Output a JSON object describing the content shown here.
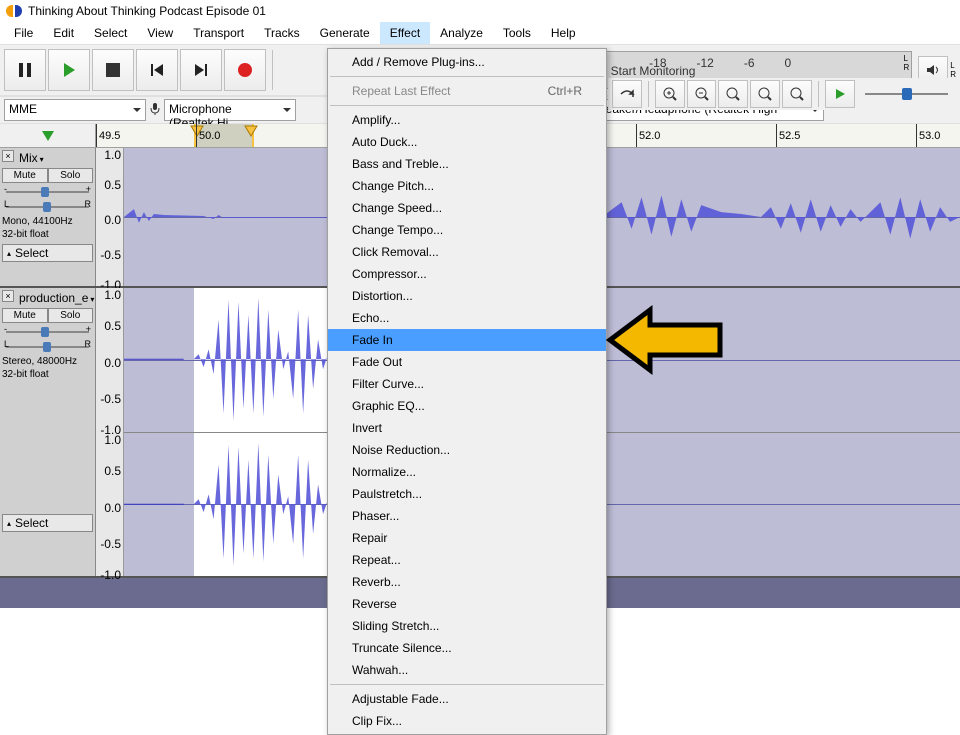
{
  "title": "Thinking About Thinking Podcast Episode 01",
  "menu": [
    "File",
    "Edit",
    "Select",
    "View",
    "Transport",
    "Tracks",
    "Generate",
    "Effect",
    "Analyze",
    "Tools",
    "Help"
  ],
  "menu_open_index": 7,
  "dropdown": {
    "top": {
      "label": "Add / Remove Plug-ins..."
    },
    "repeat": {
      "label": "Repeat Last Effect",
      "shortcut": "Ctrl+R"
    },
    "items": [
      "Amplify...",
      "Auto Duck...",
      "Bass and Treble...",
      "Change Pitch...",
      "Change Speed...",
      "Change Tempo...",
      "Click Removal...",
      "Compressor...",
      "Distortion...",
      "Echo...",
      "Fade In",
      "Fade Out",
      "Filter Curve...",
      "Graphic EQ...",
      "Invert",
      "Noise Reduction...",
      "Normalize...",
      "Paulstretch...",
      "Phaser...",
      "Repair",
      "Repeat...",
      "Reverb...",
      "Reverse",
      "Sliding Stretch...",
      "Truncate Silence...",
      "Wahwah..."
    ],
    "highlight_index": 10,
    "bottom": [
      "Adjustable Fade...",
      "Clip Fix..."
    ]
  },
  "monitor_text": "Click to Start Monitoring",
  "meter_ticks": [
    "-18",
    "-12",
    "-6",
    "0"
  ],
  "device": {
    "host": "MME",
    "input": "Microphone (Realtek Hi",
    "output": "Speaker/Headphone (Realtek High"
  },
  "ruler": {
    "ticks": [
      "49.5",
      "50.0",
      "52.0",
      "52.5",
      "53.0"
    ]
  },
  "vscale": [
    "1.0",
    "0.5",
    "0.0",
    "-0.5",
    "-1.0"
  ],
  "tracks": [
    {
      "name": "Mix",
      "mute": "Mute",
      "solo": "Solo",
      "info1": "Mono, 44100Hz",
      "info2": "32-bit float",
      "select": "Select"
    },
    {
      "name": "production_e",
      "mute": "Mute",
      "solo": "Solo",
      "info1": "Stereo, 48000Hz",
      "info2": "32-bit float",
      "select": "Select"
    }
  ],
  "gain": {
    "l": "-",
    "r": "+"
  },
  "pan": {
    "l": "L",
    "r": "R"
  }
}
